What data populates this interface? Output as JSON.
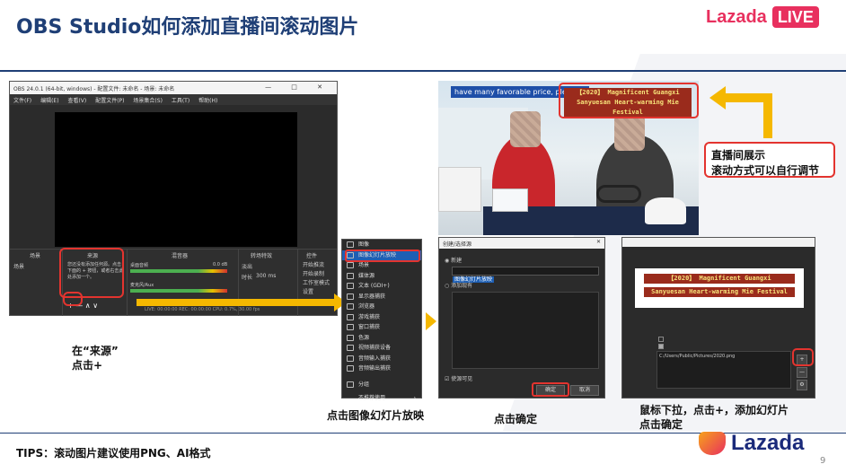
{
  "slide": {
    "title": "OBS Studio如何添加直播间滚动图片",
    "brand_name": "Lazada",
    "brand_badge": "LIVE",
    "page_number": "9",
    "footer_tips": "TIPS：滚动图片建议使用PNG、AI格式",
    "footer_logo": "Lazada"
  },
  "obs_window": {
    "title": "OBS 24.0.1 (64-bit, windows) - 配置文件: 未命名 - 场景: 未命名",
    "controls": "—  □  ✕",
    "menu": [
      "文件(F)",
      "编辑(E)",
      "查看(V)",
      "配置文件(P)",
      "场景集合(S)",
      "工具(T)",
      "帮助(H)"
    ],
    "docks": {
      "scenes": "场景",
      "sources": "来源",
      "mixer": "混音器",
      "transitions": "转场特效",
      "controls": "控件"
    },
    "scene_item": "场景",
    "sources_hint": "您还没有添加任何源。点击下面的 + 按钮，或者右击此处添加一个。",
    "mixer_1": "桌面音频",
    "mixer_2": "麦克风/Aux",
    "mixer_db": "0.0 dB",
    "transition_value": "淡出",
    "duration_label": "时长",
    "duration_value": "300 ms",
    "controls_buttons": [
      "开始推流",
      "开始录制",
      "工作室模式",
      "设置"
    ],
    "toolbar_glyphs": "+  —  ∧  ∨",
    "status": "LIVE: 00:00:00    REC: 00:00:00    CPU: 0.7%, 30.00 fps"
  },
  "captions": {
    "step1_line1": "在“来源”",
    "step1_line2": "点击+",
    "step2": "点击图像幻灯片放映",
    "step3": "点击确定",
    "step4_line1": "鼠标下拉，点击+，添加幻灯片",
    "step4_line2": "点击确定",
    "live_note_line1": "直播间展示",
    "live_note_line2": "滚动方式可以自行调节"
  },
  "source_menu": {
    "items": [
      "图像",
      "图像幻灯片放映",
      "场景",
      "媒体源",
      "文本 (GDI+)",
      "显示器捕获",
      "浏览器",
      "游戏捕获",
      "窗口捕获",
      "色源",
      "视频捕获设备",
      "音频输入捕获",
      "音频输出捕获",
      "分组",
      "不推荐使用"
    ],
    "highlighted_index": 1
  },
  "create_dialog": {
    "title": "创建/选择源",
    "option_new": "新建",
    "new_name": "图像幻灯片放映",
    "option_existing": "添加现有",
    "visible_label": "使源可见",
    "ok": "确定",
    "cancel": "取消"
  },
  "live_preview": {
    "ticker_text": "have many favorable price, please c",
    "banner_line1": "【2020】 Magnificent Guangxi",
    "banner_line2": "Sanyuesan Heart-warming Mie Festival"
  },
  "properties_dialog": {
    "banner_line1": "【2020】 Magnificent Guangxi",
    "banner_line2": "Sanyuesan Heart-warming Mie Festival",
    "path_value": "C:/Users/Public/Pictures/2020.png",
    "plus": "+",
    "minus": "—"
  },
  "colors": {
    "title": "#1f3f76",
    "brand": "#e8305e",
    "highlight_box": "#e3342f",
    "arrow": "#f5b800"
  }
}
